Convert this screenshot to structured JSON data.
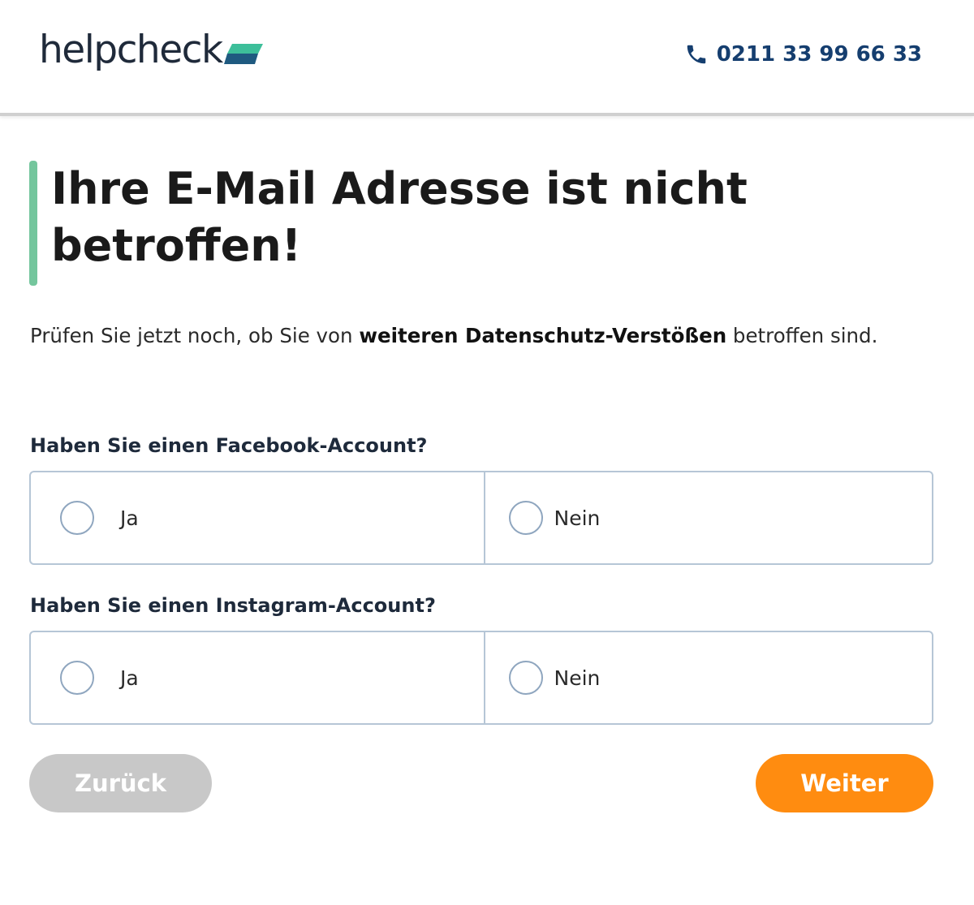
{
  "header": {
    "logo_text": "helpcheck",
    "phone_number": "0211 33 99 66 33"
  },
  "main": {
    "title": "Ihre E-Mail Adresse ist nicht betroffen!",
    "intro_prefix": "Prüfen Sie jetzt noch, ob Sie von ",
    "intro_bold": "weiteren Datenschutz-Verstößen",
    "intro_suffix": " betroffen sind."
  },
  "questions": [
    {
      "label": "Haben Sie einen Facebook-Account?",
      "options": [
        "Ja",
        "Nein"
      ]
    },
    {
      "label": "Haben Sie einen Instagram-Account?",
      "options": [
        "Ja",
        "Nein"
      ]
    }
  ],
  "buttons": {
    "back_label": "Zurück",
    "next_label": "Weiter"
  },
  "colors": {
    "accent_green": "#74c69d",
    "brand_navy": "#153e6f",
    "next_orange": "#ff8c10",
    "back_grey": "#c8c8c8"
  }
}
